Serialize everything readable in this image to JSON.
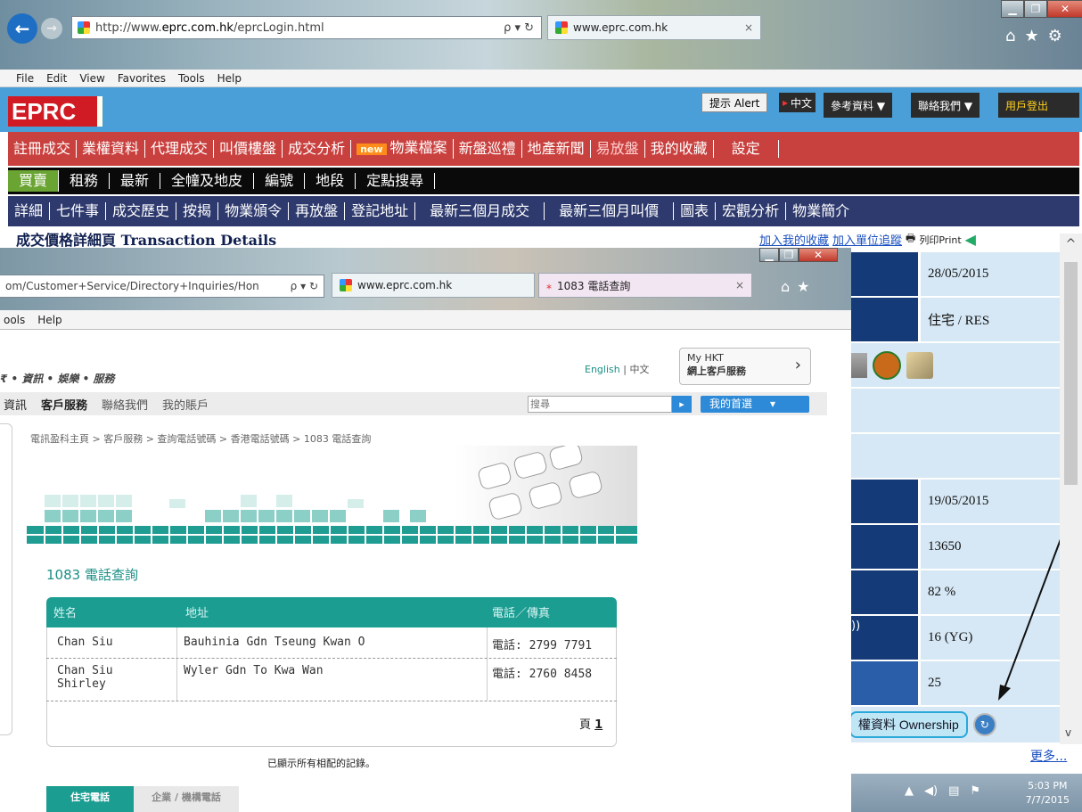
{
  "outer_browser": {
    "address_prefix": "http://www.",
    "address_host": "eprc.com.hk",
    "address_path": "/eprcLogin.html",
    "tab_title": "www.eprc.com.hk",
    "tab_close": "×",
    "search_glyph": "ρ ▾ ↻"
  },
  "menu": [
    "File",
    "Edit",
    "View",
    "Favorites",
    "Tools",
    "Help"
  ],
  "eprc": {
    "logo": "EPRC",
    "alert_btn": "提示 Alert",
    "lang": "中文",
    "top_links": [
      "參考資料 ▼",
      "聯絡我們 ▼",
      "用戶登出"
    ],
    "nav1": [
      "註冊成交",
      "業權資料",
      "代理成交",
      "叫價樓盤",
      "成交分析",
      "new",
      "物業檔案",
      "新盤巡禮",
      "地產新聞",
      "易放盤",
      "我的收藏",
      "設定"
    ],
    "nav2": [
      "買賣",
      "租務",
      "最新",
      "全幢及地皮",
      "編號",
      "地段",
      "定點搜尋"
    ],
    "nav3": [
      "詳細",
      "七件事",
      "成交歷史",
      "按揭",
      "物業頒令",
      "再放盤",
      "登記地址",
      "最新三個月成交",
      "最新三個月叫價",
      "圖表",
      "宏觀分析",
      "物業簡介"
    ],
    "detail_title": "成交價格詳細頁 Transaction Details",
    "add_fav": "加入我的收藏",
    "add_track": "加入單位追蹤",
    "print": "列印Print",
    "rows": [
      "28/05/2015",
      "住宅 / RES",
      "",
      "",
      "",
      "19/05/2015",
      "13650",
      "82 %",
      "16 (YG)",
      "25"
    ],
    "partial_label": "))",
    "ownership_btn": "權資料 Ownership",
    "more": "更多..."
  },
  "inner_browser": {
    "address": "om/Customer+Service/Directory+Inquiries/Hon",
    "tab1": "www.eprc.com.hk",
    "tab2": "1083 電話查詢",
    "menu": [
      "ools",
      "Help"
    ]
  },
  "hkt": {
    "tagline": "₹ • 資訊 • 娛樂 • 服務",
    "lang_en": "English",
    "lang_zh": "中文",
    "myhkt_1": "My HKT",
    "myhkt_2": "網上客戶服務",
    "nav": [
      "資訊",
      "客戶服務",
      "聯絡我們",
      "我的賬戶"
    ],
    "search_placeholder": "搜尋",
    "pref": "我的首選",
    "breadcrumb": "電訊盈科主頁 > 客戶服務 > 查詢電話號碼 > 香港電話號碼 > 1083 電話查詢",
    "section_title": "1083 電話查詢",
    "table": {
      "headers": [
        "姓名",
        "地址",
        "電話／傳真"
      ],
      "rows": [
        {
          "name": "Chan Siu",
          "address": "Bauhinia Gdn Tseung Kwan O",
          "phone": "電話: 2799 7791"
        },
        {
          "name": "Chan Siu\nShirley",
          "address": "Wyler Gdn To Kwa Wan",
          "phone": "電話: 2760 8458"
        }
      ],
      "page_label": "頁",
      "page_num": "1"
    },
    "all_shown": "已顯示所有相配的記錄。",
    "tab_res": "住宅電話",
    "tab_biz": "企業 / 機構電話"
  },
  "taskbar": {
    "time": "5:03 PM",
    "date": "7/7/2015"
  }
}
